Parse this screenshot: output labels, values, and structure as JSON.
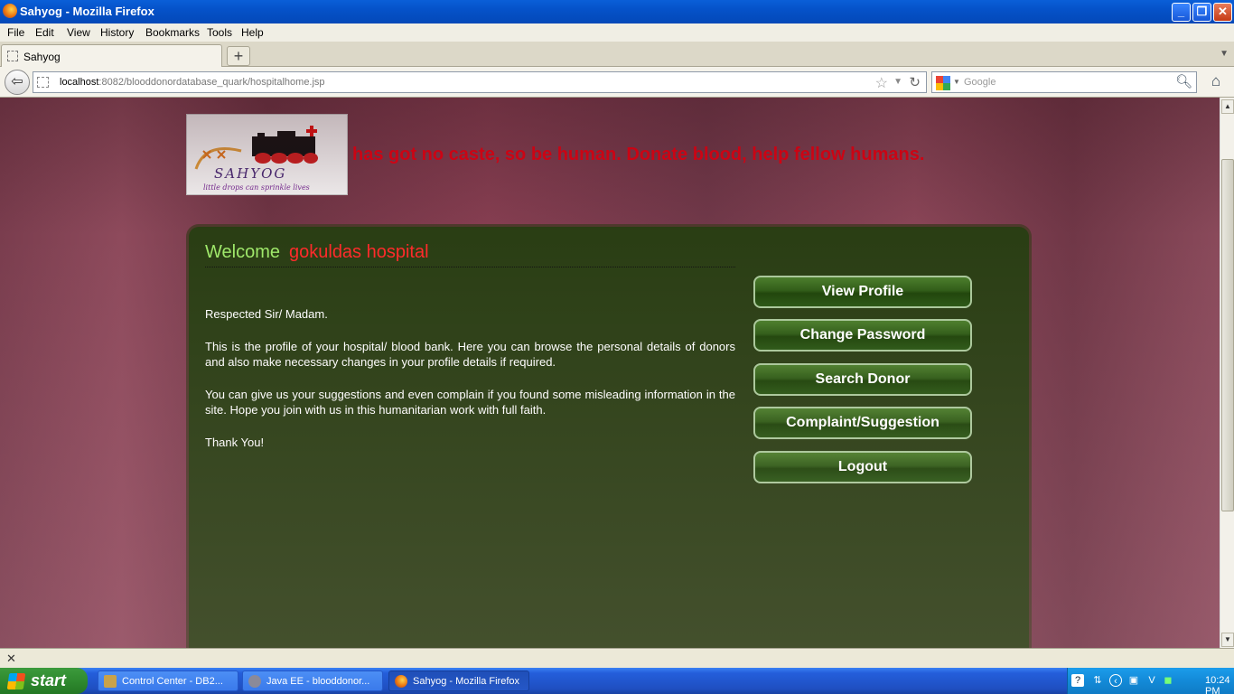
{
  "window": {
    "title": "Sahyog - Mozilla Firefox"
  },
  "menu": [
    "File",
    "Edit",
    "View",
    "History",
    "Bookmarks",
    "Tools",
    "Help"
  ],
  "tab": {
    "label": "Sahyog"
  },
  "address": {
    "host": "localhost",
    "path": ":8082/blooddonordatabase_quark/hospitalhome.jsp"
  },
  "search": {
    "placeholder": "Google"
  },
  "page": {
    "logo_text": "SAHYOG",
    "logo_tagline": "little drops can sprinkle lives",
    "marquee": "has got no caste, so be human. Donate blood, help fellow humans.",
    "welcome_label": "Welcome",
    "hospital_name": "gokuldas hospital",
    "paragraphs": [
      "Respected Sir/ Madam.",
      "This is the profile of your hospital/ blood bank. Here you can browse the personal details of donors and also make necessary changes in your profile details if required.",
      "You can give us your suggestions and even complain if you found some misleading information in the site. Hope you join with us in this humanitarian work with full faith.",
      "Thank You!"
    ],
    "buttons": {
      "view_profile": "View Profile",
      "change_password": "Change Password",
      "search_donor": "Search Donor",
      "complaint": "Complaint/Suggestion",
      "logout": "Logout"
    }
  },
  "taskbar": {
    "start": "start",
    "tasks": [
      "Control Center - DB2...",
      "Java EE - blooddonor...",
      "Sahyog - Mozilla Firefox"
    ],
    "clock": "10:24 PM"
  }
}
